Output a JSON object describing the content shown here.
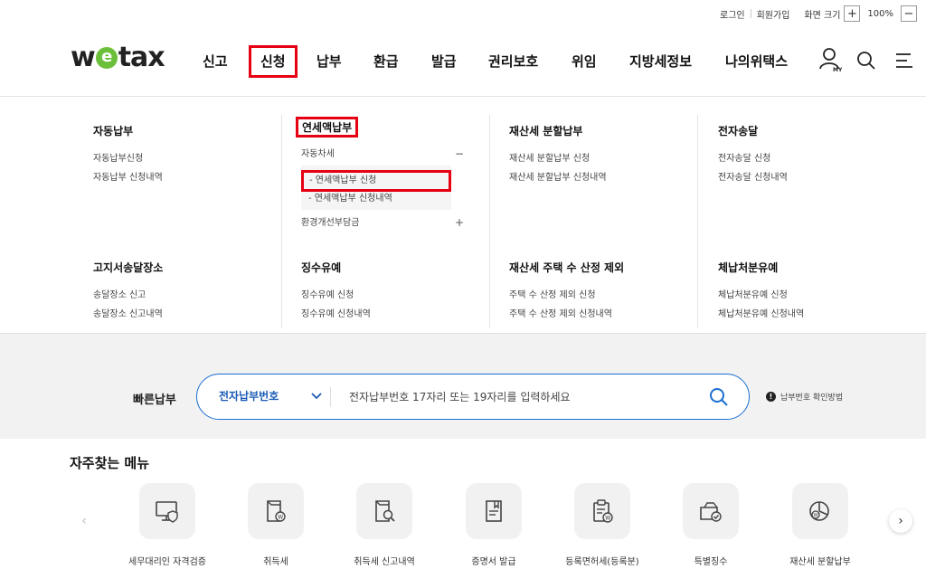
{
  "util": {
    "login": "로그인",
    "signup": "회원가입",
    "zoom_label": "화면 크기",
    "zoom_in": "+",
    "zoom_value": "100%",
    "zoom_out": "−"
  },
  "logo": {
    "w": "w",
    "e": "e",
    "tax": "tax"
  },
  "nav": [
    {
      "label": "신고"
    },
    {
      "label": "신청"
    },
    {
      "label": "납부"
    },
    {
      "label": "환급"
    },
    {
      "label": "발급"
    },
    {
      "label": "권리보호"
    },
    {
      "label": "위임"
    },
    {
      "label": "지방세정보"
    },
    {
      "label": "나의위택스"
    }
  ],
  "mega": {
    "c1": {
      "g1": {
        "title": "자동납부",
        "items": [
          "자동납부신청",
          "자동납부 신청내역"
        ]
      },
      "g2": {
        "title": "고지서송달장소",
        "items": [
          "송달장소 신고",
          "송달장소 신고내역"
        ]
      }
    },
    "c2": {
      "g1": {
        "title": "연세액납부",
        "car_tax": "자동차세",
        "minus": "−",
        "sub": [
          "- 연세액납부 신청",
          "- 연세액납부 신청내역"
        ],
        "env": "환경개선부담금",
        "plus": "+"
      },
      "g2": {
        "title": "징수유예",
        "items": [
          "징수유예 신청",
          "징수유예 신청내역"
        ]
      }
    },
    "c3": {
      "g1": {
        "title": "재산세 분할납부",
        "items": [
          "재산세 분할납부 신청",
          "재산세 분할납부 신청내역"
        ]
      },
      "g2": {
        "title": "재산세 주택 수 산정 제외",
        "items": [
          "주택 수 산정 제외 신청",
          "주택 수 산정 제외 신청내역"
        ]
      }
    },
    "c4": {
      "g1": {
        "title": "전자송달",
        "items": [
          "전자송달 신청",
          "전자송달 신청내역"
        ]
      },
      "g2": {
        "title": "체납처분유예",
        "items": [
          "체납처분유예 신청",
          "체납처분유예 신청내역"
        ]
      }
    }
  },
  "quick": {
    "label": "빠른납부",
    "select": "전자납부번호",
    "placeholder": "전자납부번호 17자리 또는 19자리를 입력하세요",
    "help": "납부번호 확인방법"
  },
  "favorites": {
    "title": "자주찾는 메뉴",
    "items": [
      {
        "label": "세무대리인 자격검증",
        "icon": "monitor-shield-icon"
      },
      {
        "label": "취득세",
        "icon": "document-coin-icon"
      },
      {
        "label": "취득세 신고내역",
        "icon": "document-search-icon"
      },
      {
        "label": "증명서 발급",
        "icon": "certificate-icon"
      },
      {
        "label": "등록면허세(등록분)",
        "icon": "clipboard-coin-icon"
      },
      {
        "label": "특별징수",
        "icon": "tray-check-icon"
      },
      {
        "label": "재산세 분할납부",
        "icon": "pie-coin-icon"
      }
    ]
  }
}
